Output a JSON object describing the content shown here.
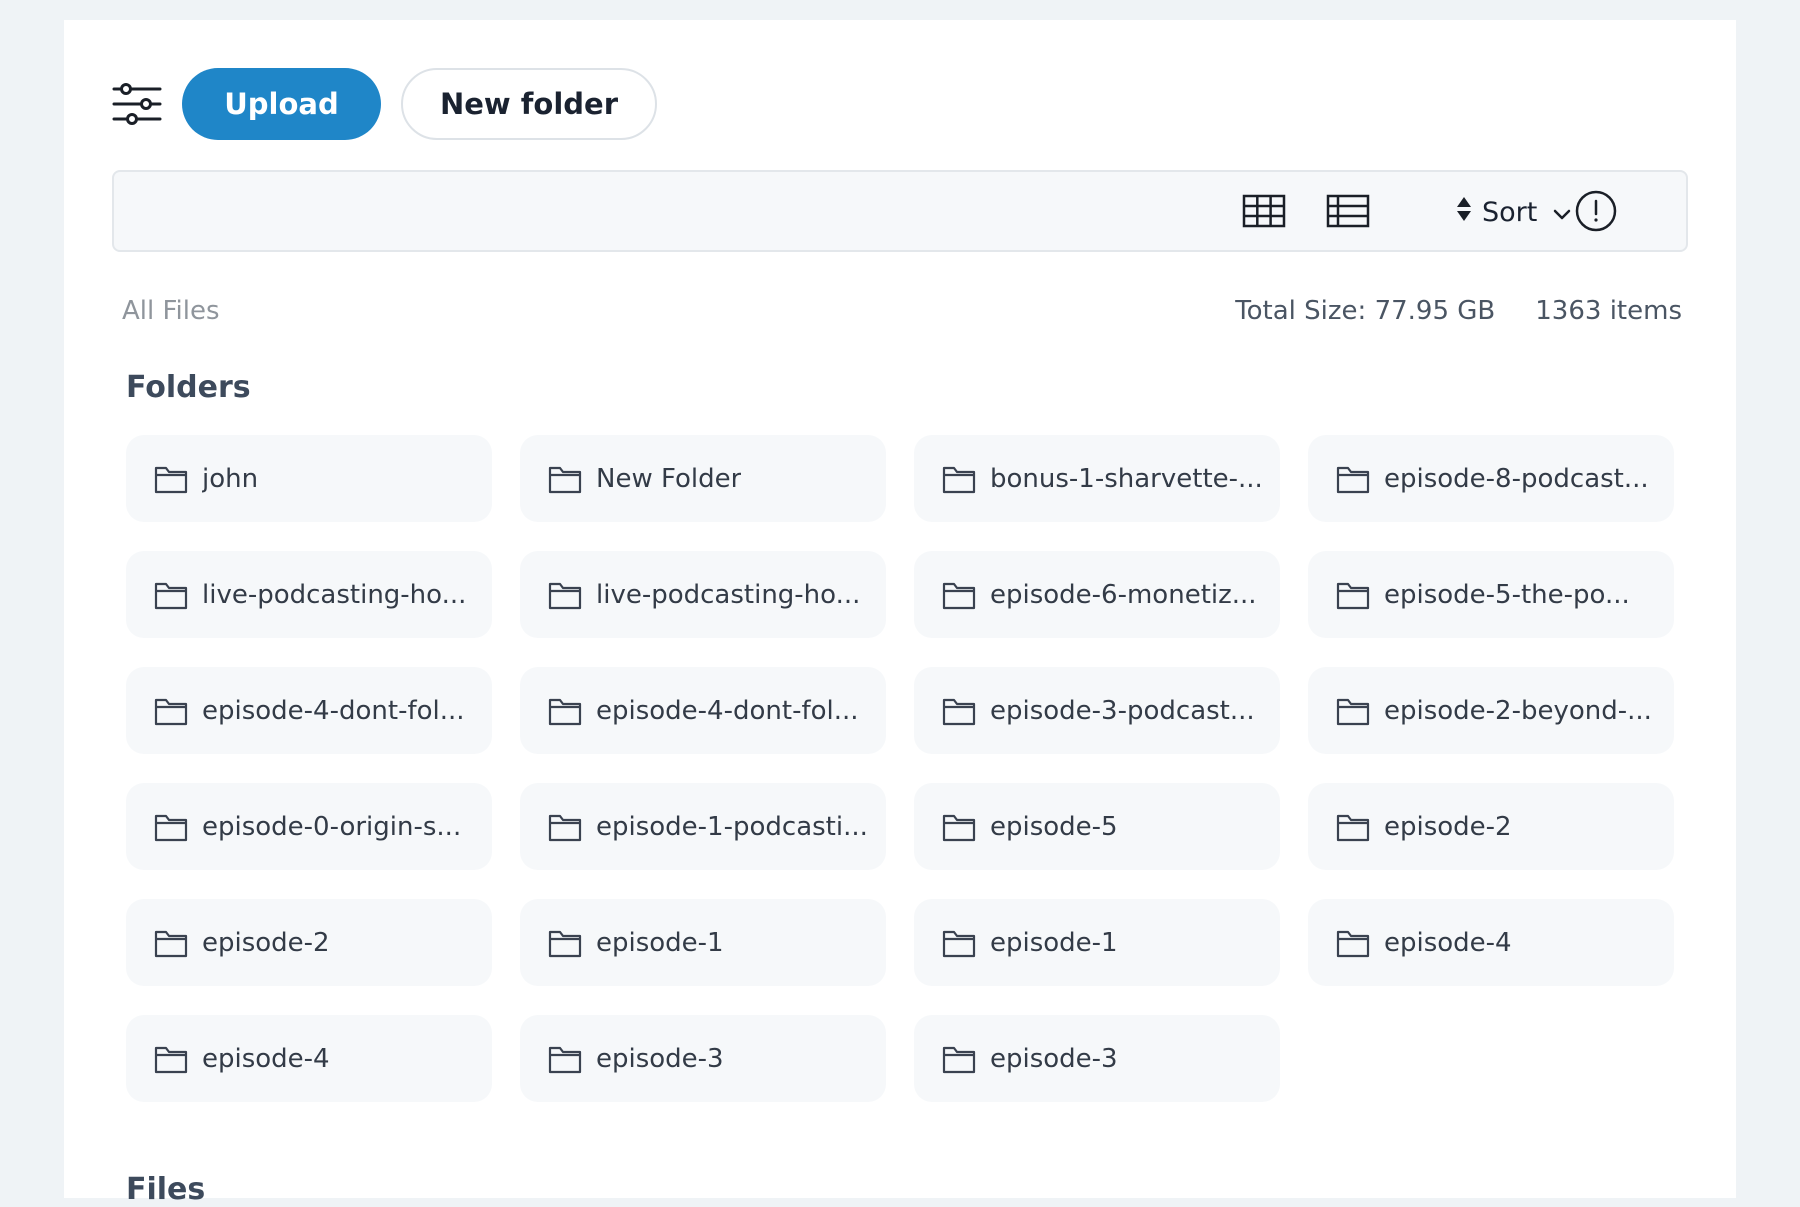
{
  "toolbar": {
    "filter_icon": "sliders-icon",
    "upload_label": "Upload",
    "new_folder_label": "New folder"
  },
  "viewbar": {
    "grid_icon": "grid-view-icon",
    "list_icon": "list-view-icon",
    "sort_label": "Sort",
    "sort_icon": "sort-arrows-icon",
    "sort_chevron": "chevron-down-icon",
    "info_icon": "info-alert-icon"
  },
  "meta": {
    "breadcrumb": "All Files",
    "total_size": "Total Size: 77.95 GB",
    "item_count": "1363 items"
  },
  "sections": {
    "folders_title": "Folders",
    "files_title": "Files"
  },
  "folders": [
    "john",
    "New Folder",
    "bonus-1-sharvette-...",
    "episode-8-podcast...",
    "live-podcasting-ho...",
    "live-podcasting-ho...",
    "episode-6-monetiz...",
    "episode-5-the-po...",
    "episode-4-dont-fol...",
    "episode-4-dont-fol...",
    "episode-3-podcast...",
    "episode-2-beyond-...",
    "episode-0-origin-s...",
    "episode-1-podcasti...",
    "episode-5",
    "episode-2",
    "episode-2",
    "episode-1",
    "episode-1",
    "episode-4",
    "episode-4",
    "episode-3",
    "episode-3"
  ],
  "colors": {
    "primary": "#1f86c8",
    "page_bg": "#eff3f6",
    "card_bg": "#f6f8fa"
  }
}
